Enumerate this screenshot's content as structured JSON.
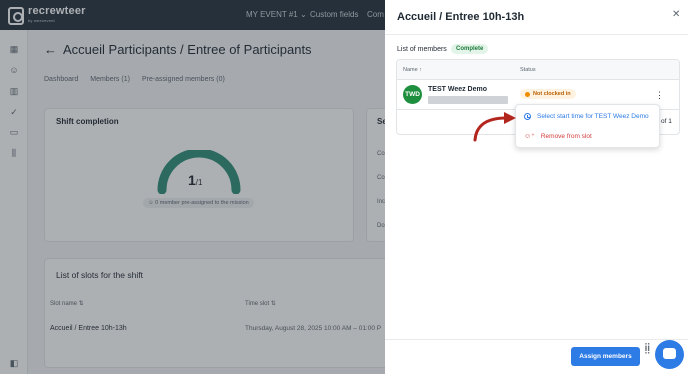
{
  "app": {
    "logo_text": "recrewteer",
    "logo_sub": "by weezevent",
    "nav": [
      "MY EVENT #1 ⌄",
      "Custom fields",
      "Com"
    ]
  },
  "page": {
    "title": "Accueil Participants / Entree of Participants",
    "tabs": [
      "Dashboard",
      "Members (1)",
      "Pre-assigned members (0)"
    ]
  },
  "shift_completion": {
    "title": "Shift completion",
    "value": "1",
    "total": "/1",
    "progress": 1.0,
    "note": "0 member pre-assigned to the mission"
  },
  "side_card": {
    "title_partial": "Se",
    "labels": [
      "Co",
      "Co",
      "Inc",
      "Do"
    ]
  },
  "slots": {
    "title": "List of slots for the shift",
    "headers": [
      "Slot name",
      "Time slot"
    ],
    "rows": [
      {
        "name": "Accueil / Entree 10h-13h",
        "time": "Thursday, August 28, 2025 10:00 AM – 01:00 P"
      }
    ]
  },
  "drawer": {
    "title": "Accueil / Entree 10h-13h",
    "list_label": "List of members",
    "complete_badge": "Complete",
    "columns": [
      "Name ↑",
      "Status"
    ],
    "members": [
      {
        "initials": "TWD",
        "name": "TEST Weez Demo",
        "status": "Not clocked in"
      }
    ],
    "pagination": "of 1",
    "assign_button": "Assign members"
  },
  "context_menu": {
    "items": [
      {
        "label": "Select start time for TEST Weez Demo",
        "icon": "clock-icon"
      },
      {
        "label": "Remove from slot",
        "icon": "remove-user-icon"
      }
    ]
  },
  "colors": {
    "primary": "#2d7be5",
    "gauge": "#2f8f7a",
    "danger": "#d23b3b",
    "arrow": "#b3261e"
  }
}
